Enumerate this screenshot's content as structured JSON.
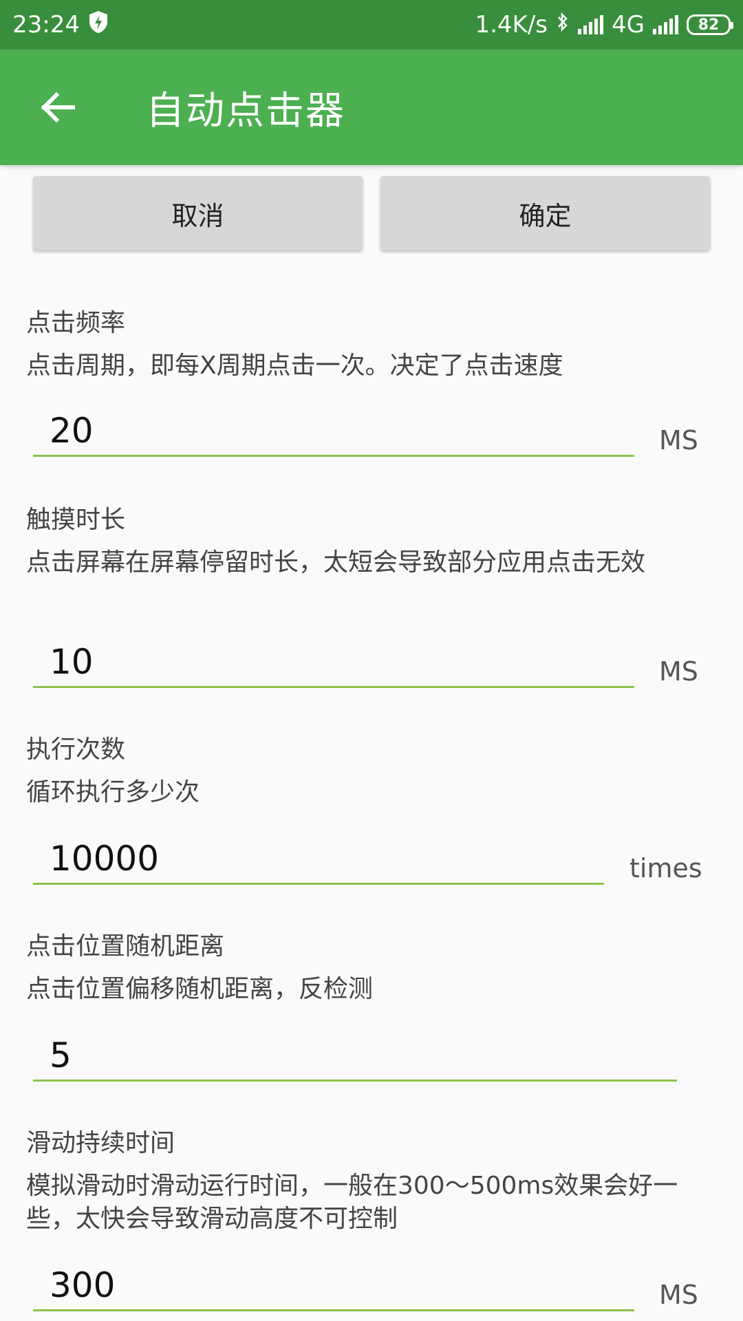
{
  "status_bar": {
    "time": "23:24",
    "speed": "1.4K/s",
    "network": "4G",
    "battery": "82"
  },
  "app_bar": {
    "title": "自动点击器"
  },
  "buttons": {
    "cancel": "取消",
    "confirm": "确定"
  },
  "settings": [
    {
      "title": "点击频率",
      "description": "点击周期，即每X周期点击一次。决定了点击速度",
      "value": "20",
      "unit": "MS"
    },
    {
      "title": "触摸时长",
      "description": "点击屏幕在屏幕停留时长，太短会导致部分应用点击无效",
      "value": "10",
      "unit": "MS"
    },
    {
      "title": "执行次数",
      "description": "循环执行多少次",
      "value": "10000",
      "unit": "times"
    },
    {
      "title": "点击位置随机距离",
      "description": "点击位置偏移随机距离，反检测",
      "value": "5",
      "unit": ""
    },
    {
      "title": "滑动持续时间",
      "description": "模拟滑动时滑动运行时间，一般在300～500ms效果会好一些，太快会导致滑动高度不可控制",
      "value": "300",
      "unit": "MS"
    }
  ]
}
